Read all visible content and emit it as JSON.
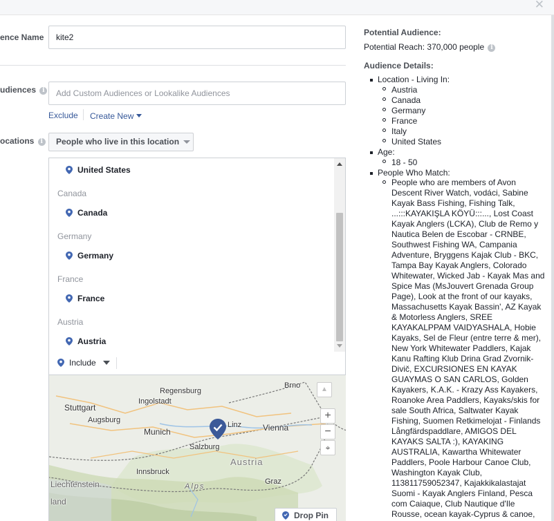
{
  "window": {
    "close_icon": "close-icon"
  },
  "form": {
    "audience_name_label": "ence Name",
    "audience_name_value": "kite2",
    "custom_audiences_label": "udiences",
    "custom_audiences_placeholder": "Add Custom Audiences or Lookalike Audiences",
    "exclude_label": "Exclude",
    "create_new_label": "Create New",
    "locations_label": "ocations",
    "location_type_selected": "People who live in this location",
    "location_groups": [
      {
        "header": "",
        "item": "United States"
      },
      {
        "header": "Canada",
        "item": "Canada"
      },
      {
        "header": "Germany",
        "item": "Germany"
      },
      {
        "header": "France",
        "item": "France"
      },
      {
        "header": "Austria",
        "item": "Austria"
      }
    ],
    "include_label": "Include",
    "drop_pin_label": "Drop Pin"
  },
  "map": {
    "labels": [
      {
        "text": "Brno",
        "kind": "city"
      },
      {
        "text": "Stuttgart",
        "kind": "city"
      },
      {
        "text": "Regensburg",
        "kind": "city"
      },
      {
        "text": "Ingolstadt",
        "kind": "city"
      },
      {
        "text": "Augsburg",
        "kind": "city"
      },
      {
        "text": "Munich",
        "kind": "city"
      },
      {
        "text": "Linz",
        "kind": "city"
      },
      {
        "text": "Vienna",
        "kind": "city"
      },
      {
        "text": "Salzburg",
        "kind": "city"
      },
      {
        "text": "Austria",
        "kind": "country"
      },
      {
        "text": "Innsbruck",
        "kind": "city"
      },
      {
        "text": "Graz",
        "kind": "city"
      },
      {
        "text": "Liechtenstein",
        "kind": "country"
      },
      {
        "text": "Alps",
        "kind": "terrain"
      },
      {
        "text": "land",
        "kind": "country"
      }
    ],
    "zoom_in": "+",
    "zoom_out": "−"
  },
  "summary": {
    "potential_audience_title": "Potential Audience:",
    "potential_reach": "Potential Reach: 370,000 people",
    "details_title": "Audience Details:",
    "location_heading": "Location - Living In:",
    "locations": [
      "Austria",
      "Canada",
      "Germany",
      "France",
      "Italy",
      "United States"
    ],
    "age_heading": "Age:",
    "age_range": "18 - 50",
    "match_heading": "People Who Match:",
    "match_text": "People who are members of Avon Descent River Watch, vodáci, Sabine Kayak Bass Fishing, Fishing Talk, ...:::KAYAKIŞLA KÖYÜ:::..., Lost Coast Kayak Anglers (LCKA), Club de Remo y Nautica Belen de Escobar - CRNBE, Southwest Fishing WA, Campania Adventure, Bryggens Kajak Club - BKC, Tampa Bay Kayak Anglers, Colorado Whitewater, Wicked Jab - Kayak Mas and Spice Mas (MsJouvert Grenada Group Page), Look at the front of our kayaks, Massachusetts Kayak Bassin', AZ Kayak & Motorless Anglers, SREE KAYAKALPPAM VAIDYASHALA, Hobie Kayaks, Sel de Fleur (entre terre & mer), New York Whitewater Paddlers, Kajak Kanu Rafting Klub Drina Grad Zvornik-Divič, EXCURSIONES EN KAYAK GUAYMAS O SAN CARLOS, Golden Kayakers, K.A.K. - Krazy Ass Kayakers, Roanoke Area Paddlers, Kayaks/skis for sale South Africa, Saltwater Kayak Fishing, Suomen Retkimelojat - Finlands Långfärdspaddlare, AMIGOS DEL KAYAKS SALTA :), KAYAKING AUSTRALIA, Kawartha Whitewater Paddlers, Poole Harbour Canoe Club, Washington Kayak Club, 113811759052347, Kajakkikalastajat Suomi - Kayak Anglers Finland, Pesca com Caiaque, Club Nautique d'Ile Rousse, ocean kayak-Cyprus & canoe,"
  },
  "colors": {
    "pin": "#4267b2",
    "link": "#365899",
    "map_land": "#e8eae4",
    "map_alps": "#cddab5"
  }
}
